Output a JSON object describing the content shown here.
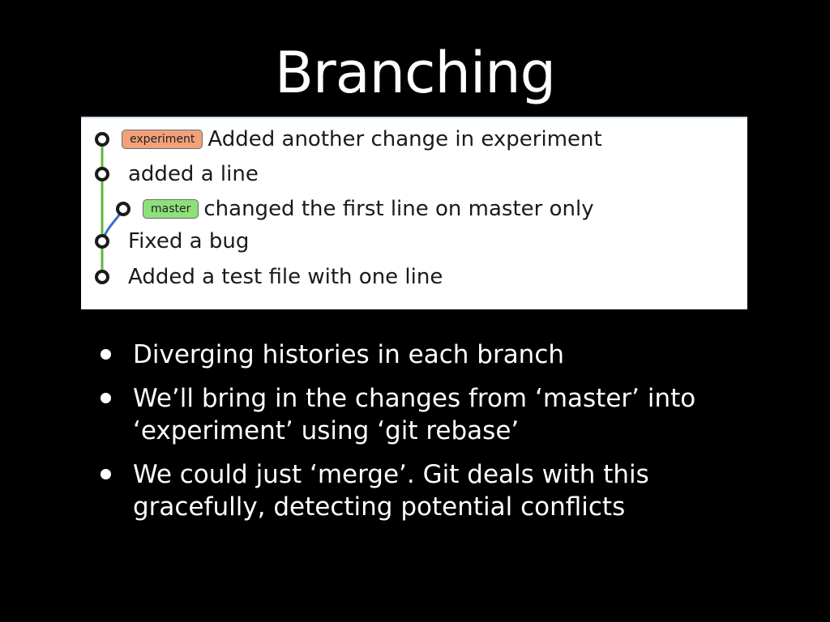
{
  "slide": {
    "title": "Branching"
  },
  "graph": {
    "colors": {
      "mainline": "#5fb83d",
      "branch": "#3a6fc9",
      "node": "#1a1a1a",
      "experiment_label": "#f2a17a",
      "master_label": "#8ee07a"
    },
    "commits": [
      {
        "ref": "experiment",
        "message": "Added another change in experiment"
      },
      {
        "ref": "",
        "message": "added a line"
      },
      {
        "ref": "master",
        "message": "changed the first line on master only"
      },
      {
        "ref": "",
        "message": "Fixed a bug"
      },
      {
        "ref": "",
        "message": "Added a test file with one line"
      }
    ]
  },
  "bullets": [
    "Diverging histories in each branch",
    "We’ll bring in the changes from ‘master’ into ‘experiment’ using ‘git rebase’",
    "We could just ‘merge’. Git deals with this gracefully, detecting potential conflicts"
  ]
}
